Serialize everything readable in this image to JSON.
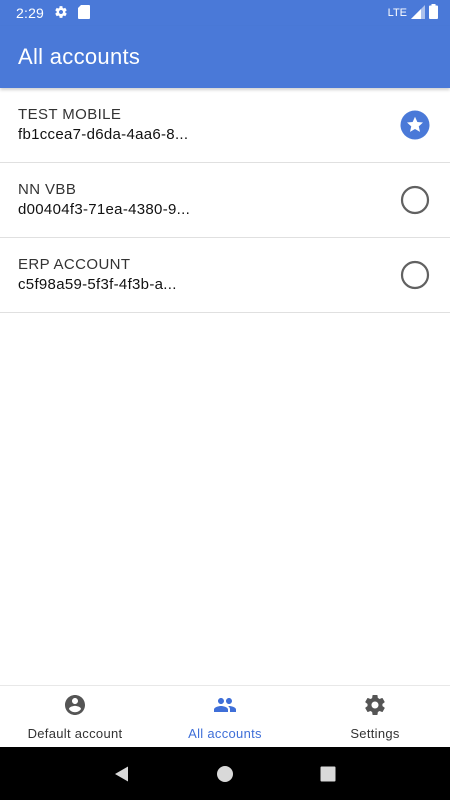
{
  "status_bar": {
    "time": "2:29",
    "network": "LTE"
  },
  "app_bar": {
    "title": "All accounts"
  },
  "accounts": [
    {
      "name": "TEST MOBILE",
      "id": "fb1ccea7-d6da-4aa6-8...",
      "selected": true
    },
    {
      "name": "NN VBB",
      "id": "d00404f3-71ea-4380-9...",
      "selected": false
    },
    {
      "name": "ERP ACCOUNT",
      "id": "c5f98a59-5f3f-4f3b-a...",
      "selected": false
    }
  ],
  "bottom_nav": {
    "items": [
      {
        "label": "Default account",
        "icon": "account-circle-icon",
        "active": false
      },
      {
        "label": "All accounts",
        "icon": "people-icon",
        "active": true
      },
      {
        "label": "Settings",
        "icon": "gear-icon",
        "active": false
      }
    ]
  },
  "colors": {
    "primary": "#4a79d8",
    "accent": "#3f6fd8",
    "divider": "#e0e0e0"
  }
}
